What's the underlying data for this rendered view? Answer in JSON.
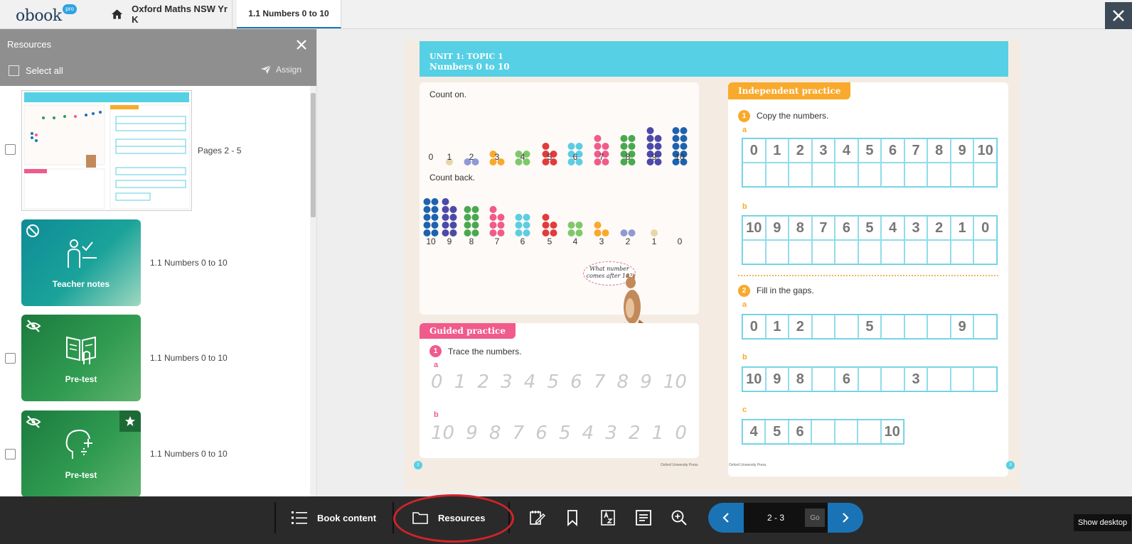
{
  "app": {
    "logo_text": "obook",
    "logo_badge": "pro",
    "tabs": [
      {
        "label": "Oxford Maths NSW Yr K"
      },
      {
        "label": "1.1 Numbers 0 to 10"
      }
    ]
  },
  "panel": {
    "title": "Resources",
    "select_all": "Select all",
    "assign": "Assign",
    "items": [
      {
        "label": "Pages 2 - 5"
      },
      {
        "card_title": "Teacher notes",
        "label": "1.1 Numbers 0 to 10"
      },
      {
        "card_title": "Pre-test",
        "label": "1.1 Numbers 0 to 10"
      },
      {
        "card_title": "Pre-test",
        "label": "1.1 Numbers 0 to 10"
      }
    ]
  },
  "page": {
    "unit_line1": "UNIT 1: TOPIC 1",
    "unit_line2": "Numbers 0 to 10",
    "count_on": "Count on.",
    "count_back": "Count back.",
    "count_on_numbers": [
      "0",
      "1",
      "2",
      "3",
      "4",
      "5",
      "6",
      "7",
      "8",
      "9",
      "10"
    ],
    "count_back_numbers": [
      "10",
      "9",
      "8",
      "7",
      "6",
      "5",
      "4",
      "3",
      "2",
      "1",
      "0"
    ],
    "speech": "What number comes after 10?",
    "guided_tag": "Guided practice",
    "guided_q1_num": "1",
    "guided_q1_text": "Trace the numbers.",
    "letter_a": "a",
    "letter_b": "b",
    "letter_c": "c",
    "trace_a": [
      "0",
      "1",
      "2",
      "3",
      "4",
      "5",
      "6",
      "7",
      "8",
      "9",
      "10"
    ],
    "trace_b": [
      "10",
      "9",
      "8",
      "7",
      "6",
      "5",
      "4",
      "3",
      "2",
      "1",
      "0"
    ],
    "indep_tag": "Independent practice",
    "indep_q1_num": "1",
    "indep_q1_text": "Copy the numbers.",
    "indep_q2_num": "2",
    "indep_q2_text": "Fill in the gaps.",
    "copy_a": [
      "0",
      "1",
      "2",
      "3",
      "4",
      "5",
      "6",
      "7",
      "8",
      "9",
      "10"
    ],
    "copy_b": [
      "10",
      "9",
      "8",
      "7",
      "6",
      "5",
      "4",
      "3",
      "2",
      "1",
      "0"
    ],
    "gaps_a": [
      "0",
      "1",
      "2",
      "",
      "",
      "5",
      "",
      "",
      "",
      "9",
      ""
    ],
    "gaps_b": [
      "10",
      "9",
      "8",
      "",
      "6",
      "",
      "",
      "3",
      "",
      "",
      ""
    ],
    "gaps_c": [
      "4",
      "5",
      "6",
      "",
      "",
      "",
      "10"
    ],
    "footer_left": "Oxford University Press",
    "footer_right": "Oxford University Press",
    "page_left": "2",
    "page_right": "3"
  },
  "toolbar": {
    "book_content": "Book content",
    "resources": "Resources",
    "page_value": "2 - 3",
    "go": "Go",
    "show_desktop": "Show desktop"
  },
  "colors": {
    "accent_blue": "#1a73b5",
    "banner_cyan": "#56d0e5",
    "guided_pink": "#f05b8c",
    "indep_orange": "#f9a92b",
    "ring_red": "#d2232a"
  }
}
